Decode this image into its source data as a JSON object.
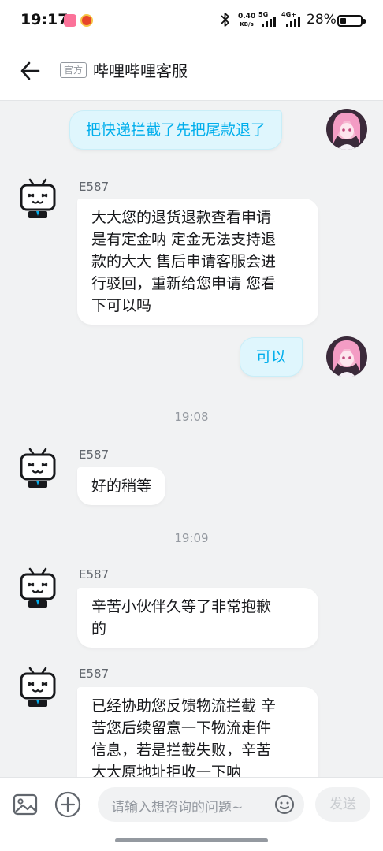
{
  "status_bar": {
    "time": "19:17",
    "net_speed_value": "0.40",
    "net_speed_unit": "KB/s",
    "sim1_tag": "5G",
    "sim2_tag": "4G+",
    "battery_percent": "28%",
    "battery_level": 0.28
  },
  "header": {
    "official_tag": "官方",
    "title": "哔哩哔哩客服"
  },
  "messages": [
    {
      "side": "right",
      "text": "把快递拦截了先把尾款退了"
    },
    {
      "side": "left",
      "sender": "E587",
      "lines": [
        "大大您的退货退款查看申请",
        "是有定金呐 定金无法支持退",
        "款的大大 售后申请客服会进",
        "行驳回，重新给您申请 您看",
        "下可以吗"
      ]
    },
    {
      "side": "right",
      "text": "可以"
    },
    {
      "timestamp": "19:08"
    },
    {
      "side": "left",
      "sender": "E587",
      "lines": [
        "好的稍等"
      ]
    },
    {
      "timestamp": "19:09"
    },
    {
      "side": "left",
      "sender": "E587",
      "lines": [
        "辛苦小伙伴久等了非常抱歉",
        "的"
      ]
    },
    {
      "side": "left",
      "sender": "E587",
      "lines": [
        "已经协助您反馈物流拦截 辛",
        "苦您后续留意一下物流走件",
        "信息，若是拦截失败，辛苦",
        "大大原地址拒收一下呐"
      ]
    }
  ],
  "input_bar": {
    "placeholder": "请输入想咨询的问题~",
    "send_label": "发送"
  },
  "colors": {
    "accent": "#00aeec",
    "right_bubble_bg": "#dff6fd",
    "page_bg": "#f1f2f3",
    "brand_pink": "#fb7299"
  },
  "icons": {
    "back": "arrow-left-icon",
    "image": "image-icon",
    "plus": "plus-circle-icon",
    "emoji": "emoji-icon",
    "bluetooth": "bluetooth-icon",
    "battery": "battery-icon"
  }
}
